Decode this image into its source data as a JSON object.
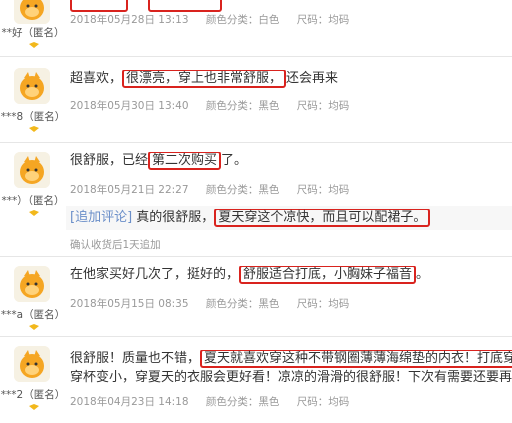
{
  "reviews": [
    {
      "user": "**好（匿名）",
      "date": "2018年05月28日 13:13",
      "color": "颜色分类：白色",
      "size": "尺码：均码"
    },
    {
      "user": "***8（匿名）",
      "content_pre": "超喜欢，",
      "content_hl": "很漂亮，穿上也非常舒服，",
      "content_post": "还会再来",
      "date": "2018年05月30日 13:40",
      "color": "颜色分类：黑色",
      "size": "尺码：均码"
    },
    {
      "user": "***）（匿名）",
      "content_pre": "很舒服，已经",
      "content_hl": "第二次购买",
      "content_post": "了。",
      "date": "2018年05月21日 22:27",
      "color": "颜色分类：黑色",
      "size": "尺码：均码",
      "addon_tag": "[追加评论]",
      "addon_pre": "真的很舒服，",
      "addon_hl": "夏天穿这个凉快，而且可以配裙子。",
      "confirm": "确认收货后1天追加"
    },
    {
      "user": "***a（匿名）",
      "content_pre": "在他家买好几次了，挺好的，",
      "content_hl": "舒服适合打底，小胸妹子福音",
      "content_post": "。",
      "date": "2018年05月15日 08:35",
      "color": "颜色分类：黑色",
      "size": "尺码：均码"
    },
    {
      "user": "***2（匿名）",
      "content_pre": "很舒服！质量也不错，",
      "content_hl": "夏天就喜欢穿这种不带钢圈薄薄海绵垫的内衣！打底穿吊带网",
      "content_line2": "穿杯变小，穿夏天的衣服会更好看！凉凉的滑滑的很舒服！下次有需要还要再来呀！",
      "date": "2018年04月23日 14:18",
      "color": "颜色分类：黑色",
      "size": "尺码：均码"
    }
  ]
}
